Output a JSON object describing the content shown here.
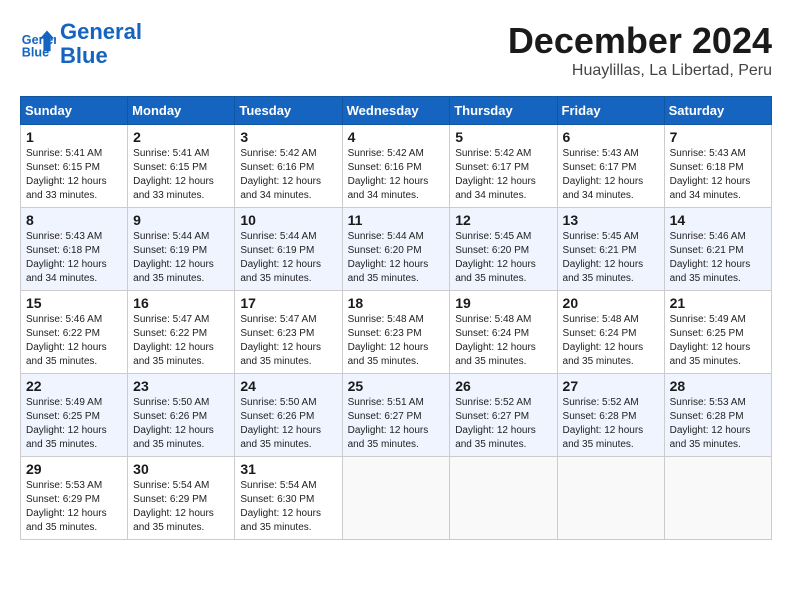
{
  "header": {
    "logo_line1": "General",
    "logo_line2": "Blue",
    "month": "December 2024",
    "location": "Huaylillas, La Libertad, Peru"
  },
  "weekdays": [
    "Sunday",
    "Monday",
    "Tuesday",
    "Wednesday",
    "Thursday",
    "Friday",
    "Saturday"
  ],
  "weeks": [
    [
      {
        "day": "1",
        "sunrise": "Sunrise: 5:41 AM",
        "sunset": "Sunset: 6:15 PM",
        "daylight": "Daylight: 12 hours and 33 minutes."
      },
      {
        "day": "2",
        "sunrise": "Sunrise: 5:41 AM",
        "sunset": "Sunset: 6:15 PM",
        "daylight": "Daylight: 12 hours and 33 minutes."
      },
      {
        "day": "3",
        "sunrise": "Sunrise: 5:42 AM",
        "sunset": "Sunset: 6:16 PM",
        "daylight": "Daylight: 12 hours and 34 minutes."
      },
      {
        "day": "4",
        "sunrise": "Sunrise: 5:42 AM",
        "sunset": "Sunset: 6:16 PM",
        "daylight": "Daylight: 12 hours and 34 minutes."
      },
      {
        "day": "5",
        "sunrise": "Sunrise: 5:42 AM",
        "sunset": "Sunset: 6:17 PM",
        "daylight": "Daylight: 12 hours and 34 minutes."
      },
      {
        "day": "6",
        "sunrise": "Sunrise: 5:43 AM",
        "sunset": "Sunset: 6:17 PM",
        "daylight": "Daylight: 12 hours and 34 minutes."
      },
      {
        "day": "7",
        "sunrise": "Sunrise: 5:43 AM",
        "sunset": "Sunset: 6:18 PM",
        "daylight": "Daylight: 12 hours and 34 minutes."
      }
    ],
    [
      {
        "day": "8",
        "sunrise": "Sunrise: 5:43 AM",
        "sunset": "Sunset: 6:18 PM",
        "daylight": "Daylight: 12 hours and 34 minutes."
      },
      {
        "day": "9",
        "sunrise": "Sunrise: 5:44 AM",
        "sunset": "Sunset: 6:19 PM",
        "daylight": "Daylight: 12 hours and 35 minutes."
      },
      {
        "day": "10",
        "sunrise": "Sunrise: 5:44 AM",
        "sunset": "Sunset: 6:19 PM",
        "daylight": "Daylight: 12 hours and 35 minutes."
      },
      {
        "day": "11",
        "sunrise": "Sunrise: 5:44 AM",
        "sunset": "Sunset: 6:20 PM",
        "daylight": "Daylight: 12 hours and 35 minutes."
      },
      {
        "day": "12",
        "sunrise": "Sunrise: 5:45 AM",
        "sunset": "Sunset: 6:20 PM",
        "daylight": "Daylight: 12 hours and 35 minutes."
      },
      {
        "day": "13",
        "sunrise": "Sunrise: 5:45 AM",
        "sunset": "Sunset: 6:21 PM",
        "daylight": "Daylight: 12 hours and 35 minutes."
      },
      {
        "day": "14",
        "sunrise": "Sunrise: 5:46 AM",
        "sunset": "Sunset: 6:21 PM",
        "daylight": "Daylight: 12 hours and 35 minutes."
      }
    ],
    [
      {
        "day": "15",
        "sunrise": "Sunrise: 5:46 AM",
        "sunset": "Sunset: 6:22 PM",
        "daylight": "Daylight: 12 hours and 35 minutes."
      },
      {
        "day": "16",
        "sunrise": "Sunrise: 5:47 AM",
        "sunset": "Sunset: 6:22 PM",
        "daylight": "Daylight: 12 hours and 35 minutes."
      },
      {
        "day": "17",
        "sunrise": "Sunrise: 5:47 AM",
        "sunset": "Sunset: 6:23 PM",
        "daylight": "Daylight: 12 hours and 35 minutes."
      },
      {
        "day": "18",
        "sunrise": "Sunrise: 5:48 AM",
        "sunset": "Sunset: 6:23 PM",
        "daylight": "Daylight: 12 hours and 35 minutes."
      },
      {
        "day": "19",
        "sunrise": "Sunrise: 5:48 AM",
        "sunset": "Sunset: 6:24 PM",
        "daylight": "Daylight: 12 hours and 35 minutes."
      },
      {
        "day": "20",
        "sunrise": "Sunrise: 5:48 AM",
        "sunset": "Sunset: 6:24 PM",
        "daylight": "Daylight: 12 hours and 35 minutes."
      },
      {
        "day": "21",
        "sunrise": "Sunrise: 5:49 AM",
        "sunset": "Sunset: 6:25 PM",
        "daylight": "Daylight: 12 hours and 35 minutes."
      }
    ],
    [
      {
        "day": "22",
        "sunrise": "Sunrise: 5:49 AM",
        "sunset": "Sunset: 6:25 PM",
        "daylight": "Daylight: 12 hours and 35 minutes."
      },
      {
        "day": "23",
        "sunrise": "Sunrise: 5:50 AM",
        "sunset": "Sunset: 6:26 PM",
        "daylight": "Daylight: 12 hours and 35 minutes."
      },
      {
        "day": "24",
        "sunrise": "Sunrise: 5:50 AM",
        "sunset": "Sunset: 6:26 PM",
        "daylight": "Daylight: 12 hours and 35 minutes."
      },
      {
        "day": "25",
        "sunrise": "Sunrise: 5:51 AM",
        "sunset": "Sunset: 6:27 PM",
        "daylight": "Daylight: 12 hours and 35 minutes."
      },
      {
        "day": "26",
        "sunrise": "Sunrise: 5:52 AM",
        "sunset": "Sunset: 6:27 PM",
        "daylight": "Daylight: 12 hours and 35 minutes."
      },
      {
        "day": "27",
        "sunrise": "Sunrise: 5:52 AM",
        "sunset": "Sunset: 6:28 PM",
        "daylight": "Daylight: 12 hours and 35 minutes."
      },
      {
        "day": "28",
        "sunrise": "Sunrise: 5:53 AM",
        "sunset": "Sunset: 6:28 PM",
        "daylight": "Daylight: 12 hours and 35 minutes."
      }
    ],
    [
      {
        "day": "29",
        "sunrise": "Sunrise: 5:53 AM",
        "sunset": "Sunset: 6:29 PM",
        "daylight": "Daylight: 12 hours and 35 minutes."
      },
      {
        "day": "30",
        "sunrise": "Sunrise: 5:54 AM",
        "sunset": "Sunset: 6:29 PM",
        "daylight": "Daylight: 12 hours and 35 minutes."
      },
      {
        "day": "31",
        "sunrise": "Sunrise: 5:54 AM",
        "sunset": "Sunset: 6:30 PM",
        "daylight": "Daylight: 12 hours and 35 minutes."
      },
      null,
      null,
      null,
      null
    ]
  ]
}
